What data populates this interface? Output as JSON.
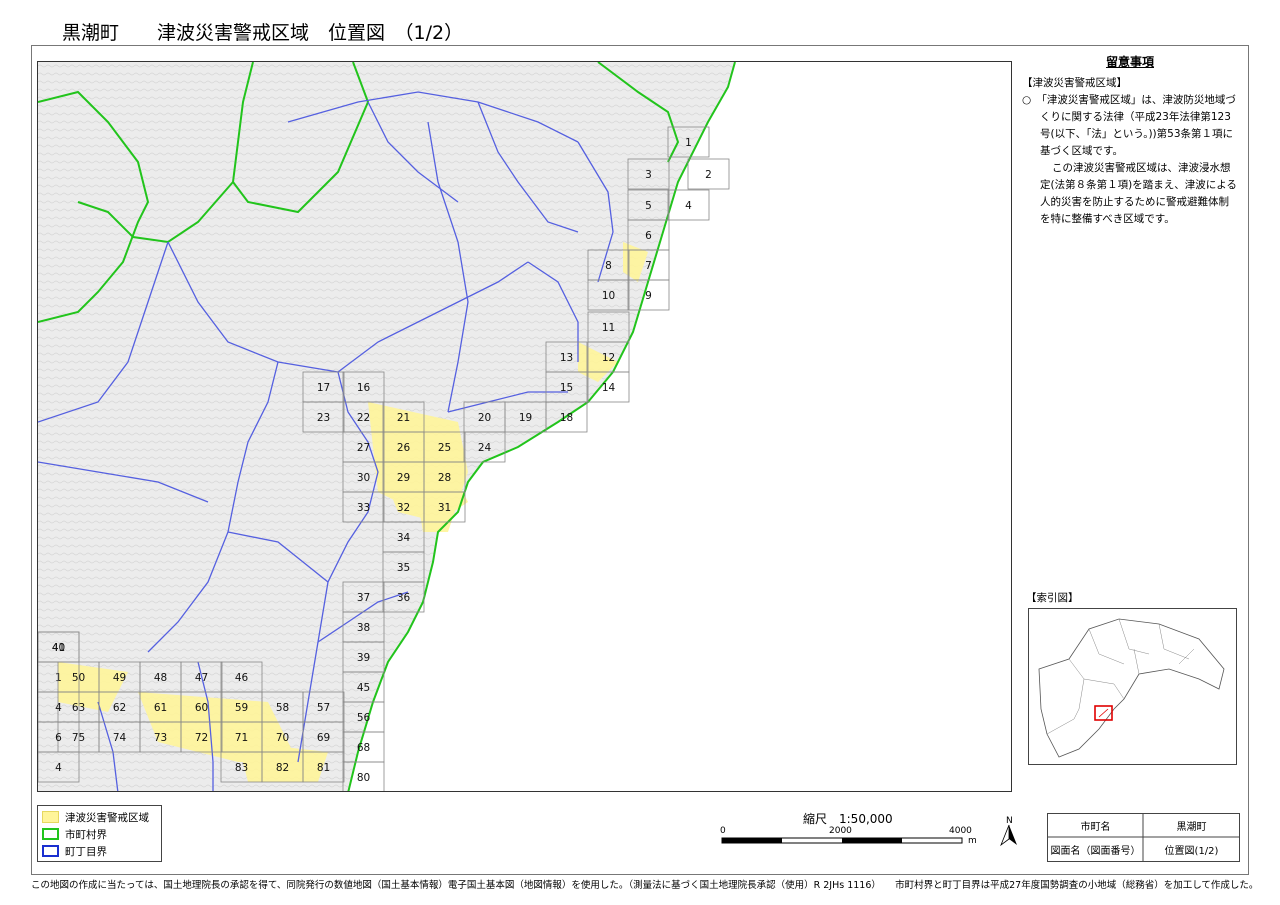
{
  "title": "黒潮町　　津波災害警戒区域　位置図　（1/2）",
  "notes": {
    "heading": "留意事項",
    "section": "【津波災害警戒区域】",
    "para1": "○　「津波災害警戒区域」は、津波防災地域づくりに関する法律（平成23年法律第123号(以下、「法」という。))第53条第１項に基づく区域です。",
    "para2": "この津波災害警戒区域は、津波浸水想定(法第８条第１項)を踏まえ、津波による人的災害を防止するために警戒避難体制を特に整備すべき区域です。"
  },
  "index_map": {
    "label": "【索引図】"
  },
  "map_boxes": [
    "1",
    "2",
    "3",
    "4",
    "5",
    "6",
    "7",
    "8",
    "9",
    "10",
    "11",
    "12",
    "13",
    "14",
    "15",
    "16",
    "17",
    "18",
    "19",
    "20",
    "21",
    "22",
    "23",
    "24",
    "25",
    "26",
    "27",
    "28",
    "29",
    "30",
    "31",
    "32",
    "33",
    "34",
    "35",
    "36",
    "37",
    "38",
    "39",
    "40",
    "1",
    "41",
    "45",
    "46",
    "47",
    "48",
    "49",
    "50",
    "56",
    "57",
    "58",
    "59",
    "60",
    "61",
    "62",
    "63",
    "4",
    "68",
    "69",
    "70",
    "71",
    "72",
    "73",
    "74",
    "75",
    "6",
    "80",
    "81",
    "82",
    "83",
    "4"
  ],
  "legend": {
    "items": [
      {
        "label": "津波災害警戒区域",
        "color": "#fff59a"
      },
      {
        "label": "市町村界",
        "color": "#22c41c"
      },
      {
        "label": "町丁目界",
        "color": "#1a2fd0"
      }
    ]
  },
  "scale": {
    "title": "縮尺　1:50,000",
    "ticks": [
      "0",
      "2000",
      "4000"
    ],
    "unit": "m"
  },
  "north_label": "N",
  "info_table": {
    "h1": "市町名",
    "v1": "黒潮町",
    "h2": "図面名（図面番号）",
    "v2": "位置図(1/2)"
  },
  "footer": "この地図の作成に当たっては、国土地理院長の承認を得て、同院発行の数値地図（国土基本情報）電子国土基本図（地図情報）を使用した。（測量法に基づく国土地理院長承認（使用）R 2JHs 1116）　　市町村界と町丁目界は平成27年度国勢調査の小地域（総務省）を加工して作成した。",
  "colors": {
    "land": "#ececec",
    "sea": "#ffffff",
    "boundary_green": "#22c41c",
    "boundary_blue": "#5560e0",
    "hazard_yellow": "#fff59a",
    "index_highlight": "#e00000"
  }
}
